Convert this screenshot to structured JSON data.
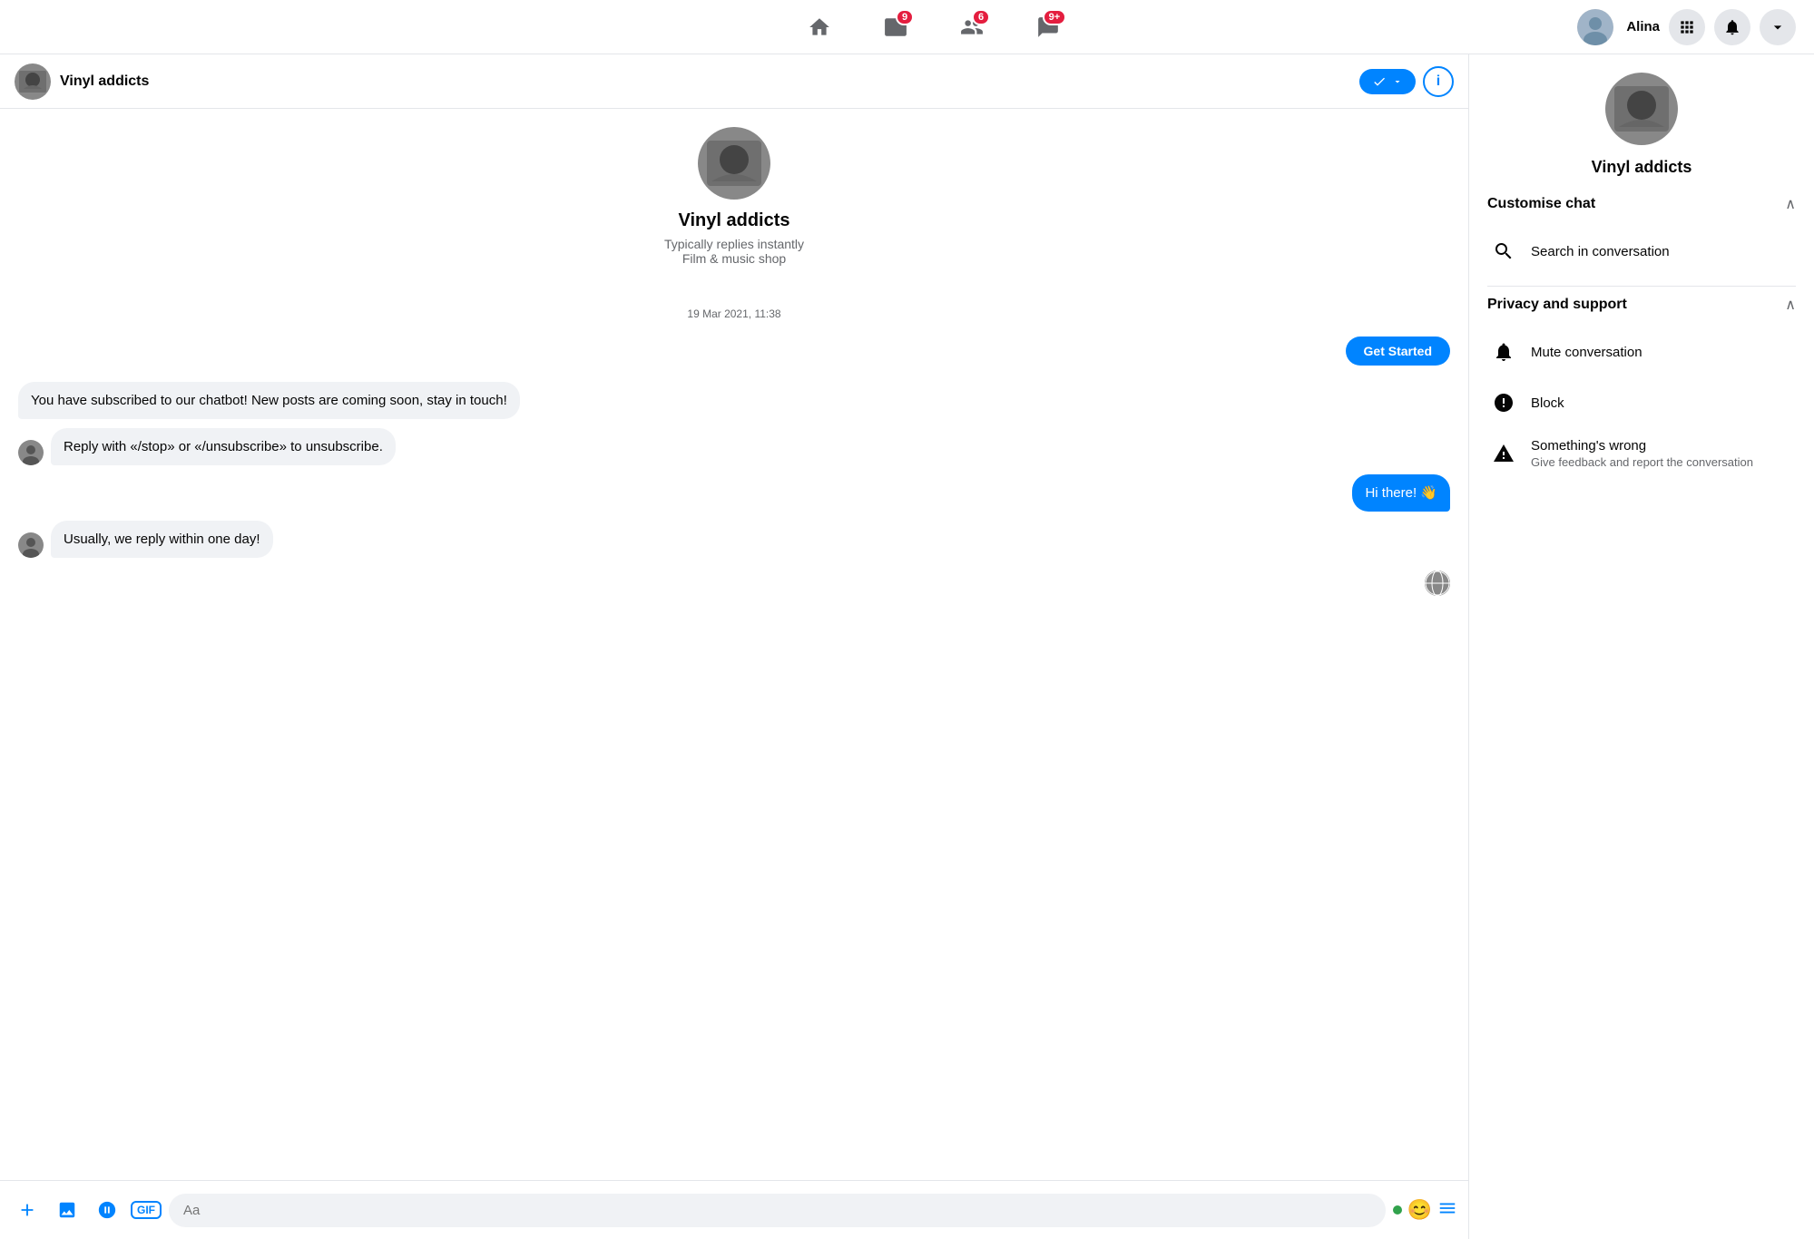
{
  "nav": {
    "username": "Alina",
    "home_badge": "",
    "video_badge": "9",
    "friends_badge": "6",
    "messages_badge": "9+"
  },
  "chat_header": {
    "name": "Vinyl addicts",
    "check_button": "✓▾",
    "info_button": "i"
  },
  "chat_intro": {
    "name": "Vinyl addicts",
    "subtitle1": "Typically replies instantly",
    "subtitle2": "Film & music shop"
  },
  "chat": {
    "timestamp": "19 Mar 2021, 11:38",
    "get_started": "Get Started",
    "messages": [
      {
        "type": "received",
        "text": "You have subscribed to our chatbot! New posts are coming soon, stay in touch!"
      },
      {
        "type": "received",
        "text": "Reply with «/stop» or «/unsubscribe» to unsubscribe."
      },
      {
        "type": "sent",
        "text": "Hi there! 👋"
      },
      {
        "type": "received",
        "text": "Usually, we reply within one day!"
      }
    ]
  },
  "input": {
    "placeholder": "Aa"
  },
  "right_panel": {
    "name": "Vinyl addicts",
    "customise_chat": "Customise chat",
    "search_in_conversation": "Search in conversation",
    "privacy_and_support": "Privacy and support",
    "mute_conversation": "Mute conversation",
    "block": "Block",
    "somethings_wrong": "Something's wrong",
    "somethings_wrong_sub": "Give feedback and report the conversation"
  }
}
